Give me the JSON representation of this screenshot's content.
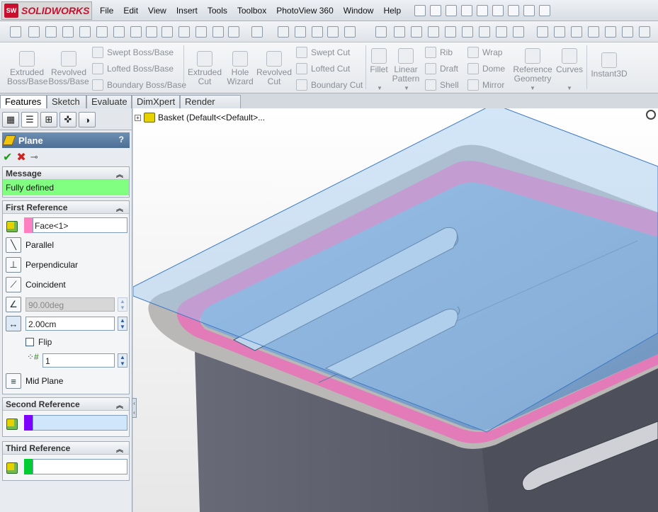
{
  "app": {
    "brand": "SOLIDWORKS",
    "brand_mark": "SW"
  },
  "menu": [
    "File",
    "Edit",
    "View",
    "Insert",
    "Tools",
    "Toolbox",
    "PhotoView 360",
    "Window",
    "Help"
  ],
  "command_manager": {
    "extruded_boss": "Extruded Boss/Base",
    "revolved_boss": "Revolved Boss/Base",
    "swept_boss": "Swept Boss/Base",
    "lofted_boss": "Lofted Boss/Base",
    "boundary_boss": "Boundary Boss/Base",
    "extruded_cut": "Extruded Cut",
    "hole_wizard": "Hole Wizard",
    "revolved_cut": "Revolved Cut",
    "swept_cut": "Swept Cut",
    "lofted_cut": "Lofted Cut",
    "boundary_cut": "Boundary Cut",
    "fillet": "Fillet",
    "linear_pattern": "Linear Pattern",
    "rib": "Rib",
    "draft": "Draft",
    "shell": "Shell",
    "wrap": "Wrap",
    "dome": "Dome",
    "mirror": "Mirror",
    "reference_geometry": "Reference Geometry",
    "curves": "Curves",
    "instant3d": "Instant3D"
  },
  "tabs": [
    "Features",
    "Sketch",
    "Evaluate",
    "DimXpert",
    "Render Tools"
  ],
  "property_manager": {
    "title": "Plane",
    "help": "?",
    "message_header": "Message",
    "message": "Fully defined",
    "first_reference": {
      "header": "First Reference",
      "selection": "Face<1>",
      "swatch_color": "#ff80c0",
      "options": {
        "parallel": "Parallel",
        "perpendicular": "Perpendicular",
        "coincident": "Coincident"
      },
      "angle": "90.00deg",
      "distance": "2.00cm",
      "flip": "Flip",
      "count": "1",
      "mid_plane": "Mid Plane"
    },
    "second_reference": {
      "header": "Second Reference",
      "swatch_color": "#8000ff"
    },
    "third_reference": {
      "header": "Third Reference",
      "swatch_color": "#00cc33"
    }
  },
  "tree": {
    "root": "Basket  (Default<<Default>..."
  },
  "colors": {
    "plane_fill": "#9ec7ef",
    "body_gray": "#5a5c68",
    "rim_gray": "#b9b8b6",
    "highlight_pink": "#e27bb8"
  }
}
